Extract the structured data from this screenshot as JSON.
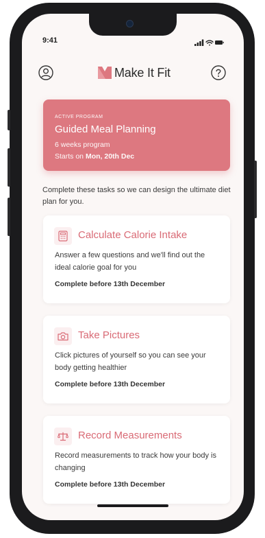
{
  "status": {
    "time": "9:41"
  },
  "header": {
    "app_name": "Make It Fit",
    "profile_icon": "user-icon",
    "help_icon": "help-icon"
  },
  "program": {
    "eyebrow": "ACTIVE PROGRAM",
    "title": "Guided Meal Planning",
    "duration": "6 weeks program",
    "starts_prefix": "Starts on ",
    "starts_date": "Mon, 20th Dec"
  },
  "intro": "Complete these tasks so we can design the ultimate diet plan for you.",
  "tasks": [
    {
      "icon": "calculator-icon",
      "title": "Calculate Calorie Intake",
      "description": "Answer a few questions and we'll find out the ideal calorie goal for you",
      "due": "Complete before 13th December"
    },
    {
      "icon": "camera-icon",
      "title": "Take Pictures",
      "description": "Click pictures of yourself so you can see your body getting healthier",
      "due": "Complete before 13th December"
    },
    {
      "icon": "scale-icon",
      "title": "Record Measurements",
      "description": "Record measurements to track how your body is changing",
      "due": "Complete before 13th December"
    }
  ],
  "colors": {
    "accent": "#dd7880",
    "accent_text": "#d96a75",
    "background": "#fbf7f6"
  }
}
